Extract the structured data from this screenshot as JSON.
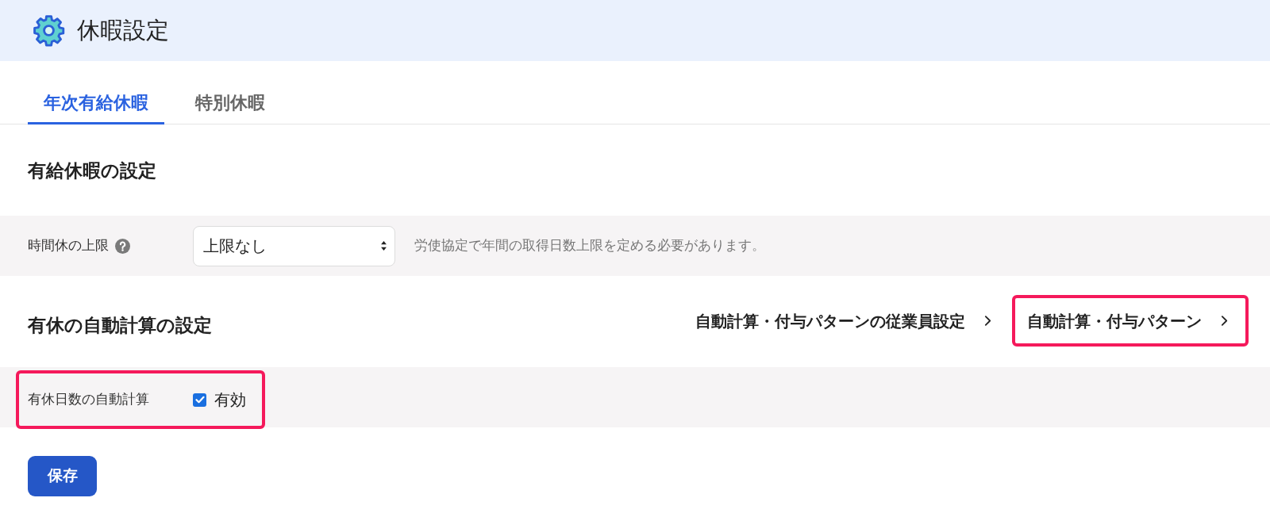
{
  "header": {
    "title": "休暇設定"
  },
  "tabs": [
    {
      "label": "年次有給休暇",
      "selected": true
    },
    {
      "label": "特別休暇",
      "selected": false
    }
  ],
  "sections": [
    {
      "heading": "有給休暇の設定",
      "rows": [
        {
          "kind": "select",
          "label": "時間休の上限",
          "help": true,
          "value": "上限なし",
          "hint": "労使協定で年間の取得日数上限を定める必要があります。",
          "highlighted": false
        }
      ]
    },
    {
      "heading": "有休の自動計算の設定",
      "links": [
        {
          "label": "自動計算・付与パターンの従業員設定",
          "highlighted": false
        },
        {
          "label": "自動計算・付与パターン",
          "highlighted": true
        }
      ],
      "rows": [
        {
          "kind": "checkbox",
          "label": "有休日数の自動計算",
          "checked": true,
          "option": "有効",
          "highlighted": true
        }
      ]
    }
  ],
  "save_button": "保存"
}
